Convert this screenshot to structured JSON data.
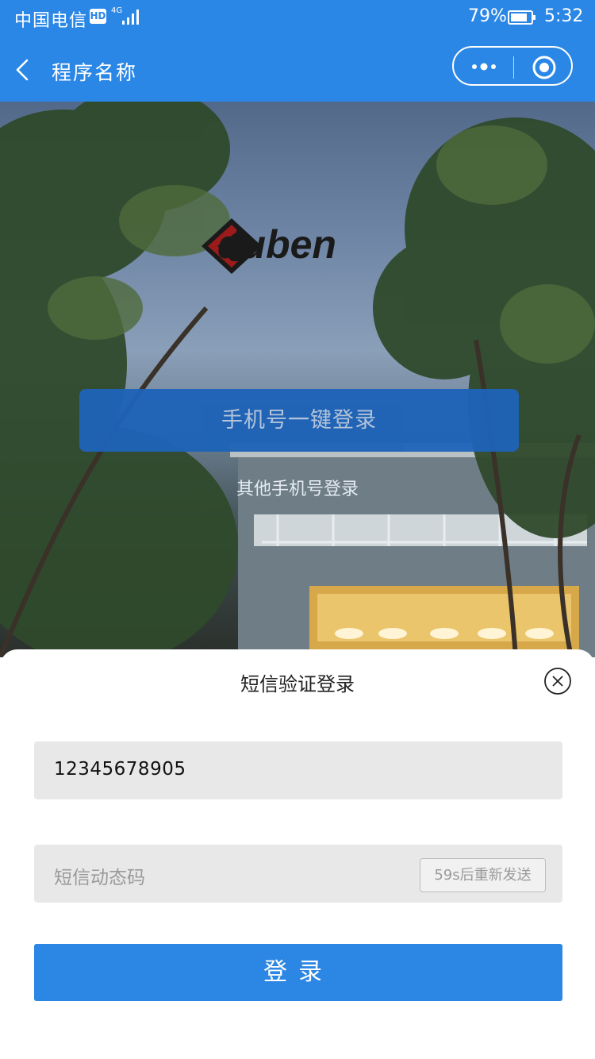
{
  "status_bar": {
    "carrier": "中国电信",
    "hd": "HD",
    "network": "4G",
    "battery_percent": "79%",
    "time": "5:32"
  },
  "nav": {
    "title": "程序名称",
    "back_icon": "chevron-left-icon",
    "more_icon": "more-dots-icon",
    "close_icon": "target-circle-icon"
  },
  "hero": {
    "logo_text": "duben",
    "onekey_login": "手机号一键登录",
    "other_phone_login": "其他手机号登录"
  },
  "sheet": {
    "title": "短信验证登录",
    "close_icon": "close-circle-icon",
    "phone_value": "12345678905",
    "code_placeholder": "短信动态码",
    "resend_label": "59s后重新发送",
    "login_label": "登录"
  },
  "colors": {
    "primary": "#2b87e6",
    "onekey_button": "#1d63b8",
    "field_bg": "#e8e8e8"
  }
}
